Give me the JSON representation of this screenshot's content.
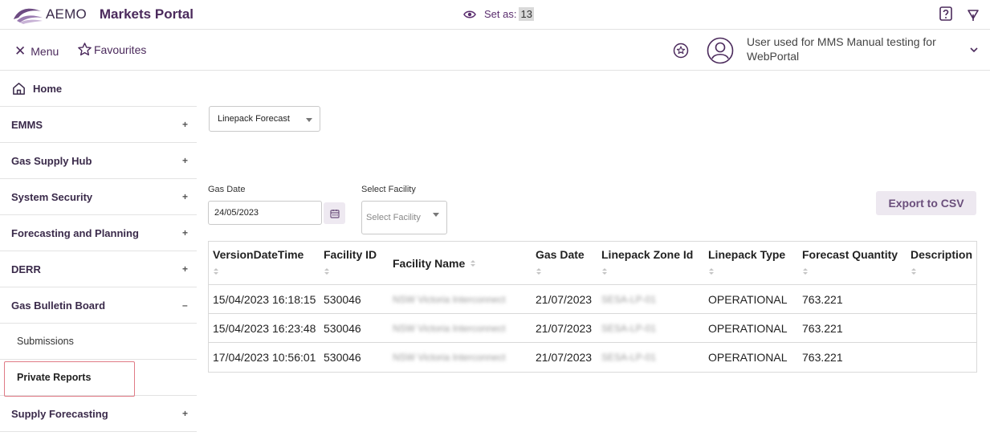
{
  "app": {
    "logo_text": "AEMO",
    "portal_name": "Markets Portal",
    "set_as_label": "Set as:",
    "set_as_value": "13"
  },
  "toolbar": {
    "menu_label": "Menu",
    "favourites_label": "Favourites",
    "user_name": "User used for MMS Manual testing for WebPortal"
  },
  "sidebar": {
    "home": "Home",
    "items": [
      {
        "label": "EMMS",
        "sign": "+"
      },
      {
        "label": "Gas Supply Hub",
        "sign": "+"
      },
      {
        "label": "System Security",
        "sign": "+"
      },
      {
        "label": "Forecasting and Planning",
        "sign": "+"
      },
      {
        "label": "DERR",
        "sign": "+"
      },
      {
        "label": "Gas Bulletin Board",
        "sign": "–"
      }
    ],
    "sub_items": [
      "Submissions",
      "Private Reports"
    ],
    "after_items": [
      {
        "label": "Supply Forecasting",
        "sign": "+"
      }
    ]
  },
  "filters": {
    "report_value": "Linepack Forecast",
    "gas_date_label": "Gas Date",
    "gas_date_value": "24/05/2023",
    "facility_label": "Select Facility",
    "facility_placeholder": "Select Facility",
    "export_label": "Export to CSV"
  },
  "table": {
    "columns": [
      "VersionDateTime",
      "Facility ID",
      "Facility Name",
      "Gas Date",
      "Linepack Zone Id",
      "Linepack Type",
      "Forecast Quantity",
      "Description"
    ],
    "rows": [
      [
        "15/04/2023 16:18:15",
        "530046",
        "NSW Victoria Interconnect",
        "21/07/2023",
        "SESA-LP-01",
        "OPERATIONAL",
        "763.221",
        ""
      ],
      [
        "15/04/2023 16:23:48",
        "530046",
        "NSW Victoria Interconnect",
        "21/07/2023",
        "SESA-LP-01",
        "OPERATIONAL",
        "763.221",
        ""
      ],
      [
        "17/04/2023 10:56:01",
        "530046",
        "NSW Victoria Interconnect",
        "21/07/2023",
        "SESA-LP-01",
        "OPERATIONAL",
        "763.221",
        ""
      ]
    ]
  },
  "colors": {
    "brand_purple": "#4b2a5c",
    "active_outline": "#e07b86",
    "export_bg": "#ede8f0"
  }
}
